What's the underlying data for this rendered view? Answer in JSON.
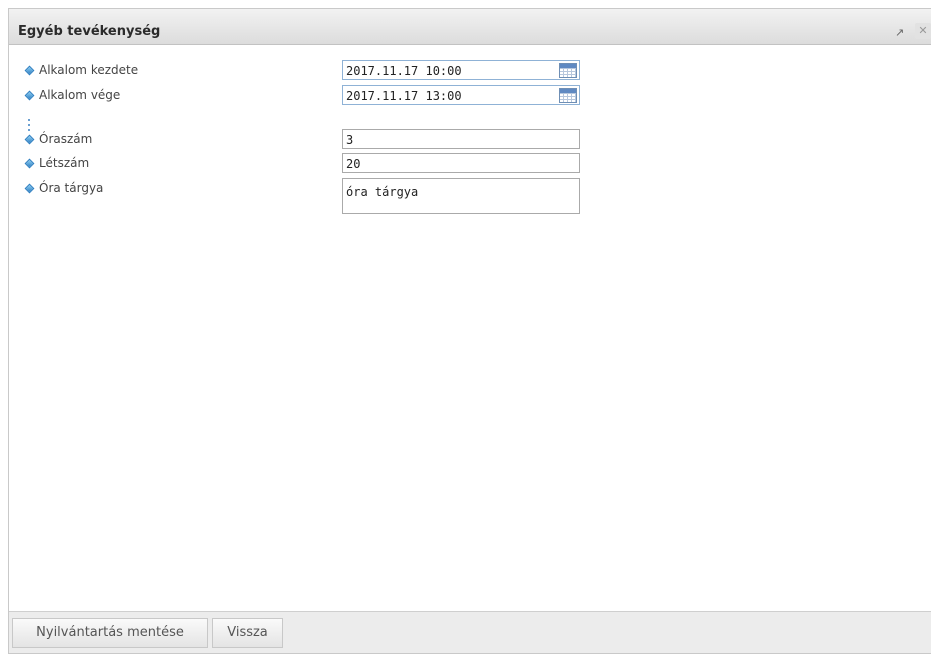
{
  "window": {
    "title": "Egyéb tevékenység",
    "maximize_icon": "↗",
    "close_icon": "✕"
  },
  "form": {
    "fields": [
      {
        "label": "Alkalom kezdete",
        "value": "2017.11.17 10:00"
      },
      {
        "label": "Alkalom vége",
        "value": "2017.11.17 13:00"
      },
      {
        "label": "Óraszám",
        "value": "3"
      },
      {
        "label": "Létszám",
        "value": "20"
      },
      {
        "label": "Óra tárgya",
        "value": "óra tárgya"
      }
    ]
  },
  "footer": {
    "save_label": "Nyilvántartás mentése",
    "back_label": "Vissza"
  },
  "colors": {
    "accent": "#2f7fc1",
    "titlebar": "#dcdcdc",
    "footer": "#ececec"
  }
}
